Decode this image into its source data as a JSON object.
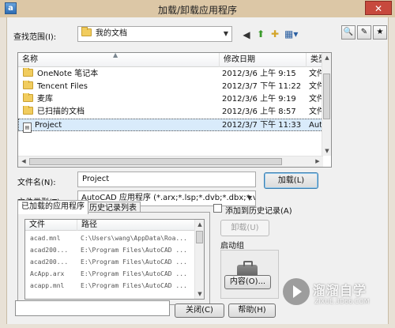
{
  "window": {
    "app_icon": "a",
    "title": "加载/卸载应用程序",
    "close": "✕"
  },
  "lookin": {
    "label": "查找范围(I):",
    "value": "我的文档"
  },
  "toolbar_icons": [
    "back-icon",
    "up-folder-icon",
    "new-folder-icon",
    "views-icon"
  ],
  "filelist": {
    "headers": {
      "name": "名称",
      "date": "修改日期",
      "type": "类型"
    },
    "rows": [
      {
        "name": "OneNote 笔记本",
        "date": "2012/3/6 上午 9:15",
        "type": "文件",
        "icon": "folder"
      },
      {
        "name": "Tencent Files",
        "date": "2012/3/7 下午 11:22",
        "type": "文件",
        "icon": "folder"
      },
      {
        "name": "麦库",
        "date": "2012/3/6 上午 9:19",
        "type": "文件",
        "icon": "folder"
      },
      {
        "name": "已扫描的文档",
        "date": "2012/3/6 上午 8:57",
        "type": "文件",
        "icon": "folder"
      },
      {
        "name": "Project",
        "date": "2012/3/7 下午 11:33",
        "type": "Autc",
        "icon": "document",
        "selected": true
      }
    ]
  },
  "filename": {
    "label": "文件名(N):",
    "value": "Project"
  },
  "filetype": {
    "label": "文件类型(T):",
    "value": "AutoCAD 应用程序 (*.arx;*.lsp;*.dvb;*.dbx;*.vlx"
  },
  "load_button": "加载(L)",
  "tabs": {
    "loaded": "已加载的应用程序",
    "history": "历史记录列表"
  },
  "applist": {
    "headers": {
      "file": "文件",
      "path": "路径"
    },
    "rows": [
      {
        "file": "acad.mnl",
        "path": "C:\\Users\\wang\\AppData\\Roa..."
      },
      {
        "file": "acad200...",
        "path": "E:\\Program Files\\AutoCAD ..."
      },
      {
        "file": "acad200...",
        "path": "E:\\Program Files\\AutoCAD ..."
      },
      {
        "file": "AcApp.arx",
        "path": "E:\\Program Files\\AutoCAD ..."
      },
      {
        "file": "acapp.mnl",
        "path": "E:\\Program Files\\AutoCAD ..."
      }
    ]
  },
  "add_history": "添加到历史记录(A)",
  "unload_button": "卸载(U)",
  "startup": {
    "label": "启动组",
    "contents_button": "内容(O)..."
  },
  "close_button": "关闭(C)",
  "help_button": "帮助(H)",
  "watermark": {
    "title": "溜溜自学",
    "sub": "ZIXUE.3D66.COM"
  }
}
